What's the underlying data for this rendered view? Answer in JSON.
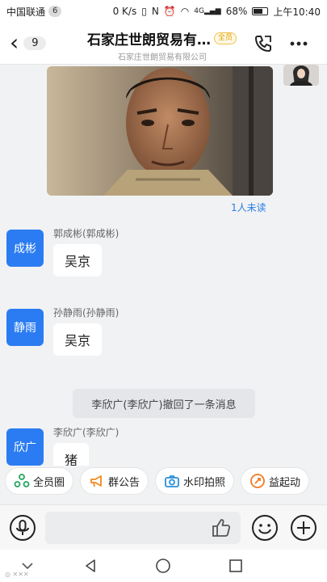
{
  "status_bar": {
    "carrier": "中国联通",
    "notif_count": "6",
    "speed": "0 K/s",
    "signal_label": "4G",
    "battery": "68%",
    "battery_level": 0.68,
    "time": "上午10:40"
  },
  "header": {
    "back_count": "9",
    "title": "石家庄世朗贸易有…",
    "tag": "全员",
    "subtitle": "石家庄世朗贸易有限公司"
  },
  "chat": {
    "unread": "1人未读",
    "messages": [
      {
        "avatar": "成彬",
        "sender": "郭成彬(郭成彬)",
        "text": "吴京"
      },
      {
        "avatar": "静雨",
        "sender": "孙静雨(孙静雨)",
        "text": "吴京"
      },
      {
        "avatar": "欣广",
        "sender": "李欣广(李欣广)",
        "text": "猪"
      }
    ],
    "system_message": "李欣广(李欣广)撤回了一条消息"
  },
  "quick_actions": [
    "全员圈",
    "群公告",
    "水印拍照",
    "益起动"
  ],
  "colors": {
    "accent": "#2b7cf2",
    "link": "#2a7ce3"
  }
}
